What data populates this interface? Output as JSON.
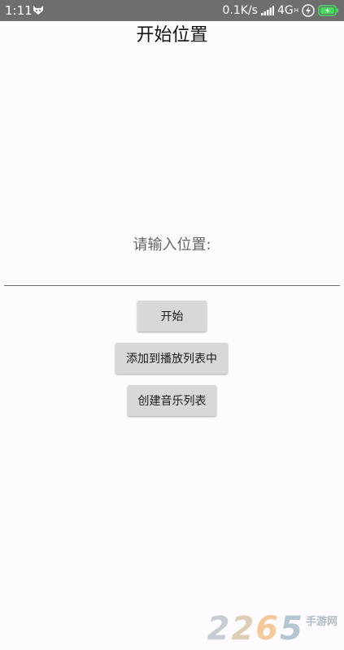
{
  "status_bar": {
    "time": "1:11",
    "net_speed": "0.1K/s",
    "net_type": "4G",
    "net_type_sub": "H",
    "icons": [
      "fox-icon",
      "signal-icon",
      "charge-icon",
      "battery-icon"
    ],
    "background": "#6e6e6e",
    "battery_color": "#4cd964"
  },
  "page": {
    "title": "开始位置",
    "input_label": "请输入位置:",
    "input_value": "",
    "input_placeholder": ""
  },
  "buttons": {
    "start": "开始",
    "add_to_playlist": "添加到播放列表中",
    "create_music_list": "创建音乐列表"
  },
  "watermark": {
    "digits": [
      "2",
      "2",
      "6",
      "5"
    ],
    "text": "手游网",
    "colors": [
      "#9aa9b6",
      "#c3ab7a",
      "#f0a34a",
      "#7a9bb0"
    ]
  }
}
